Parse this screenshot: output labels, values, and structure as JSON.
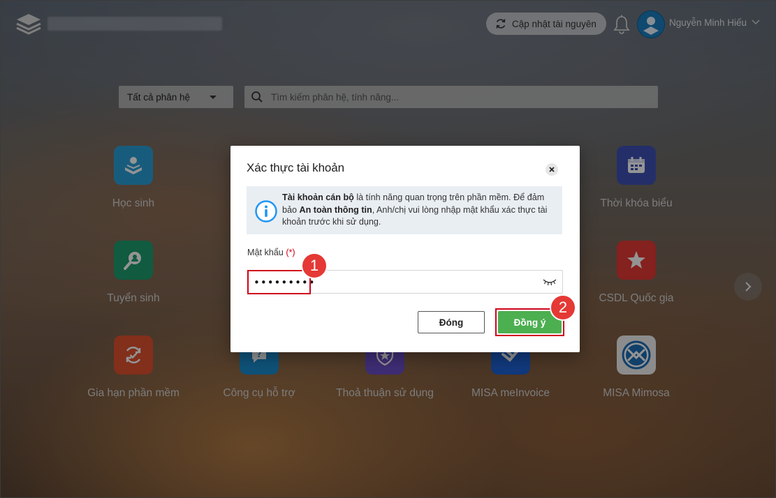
{
  "header": {
    "update_label": "Cập nhật tài nguyên",
    "user_name": "Nguyễn Minh Hiếu"
  },
  "filters": {
    "module_selected": "Tất cả phân hệ",
    "search_placeholder": "Tìm kiếm phân hệ, tính năng..."
  },
  "tiles": [
    {
      "label": "Học sinh",
      "icon": "student-book-icon",
      "color": "#2a9fd8"
    },
    {
      "label": "Thời khóa biểu",
      "icon": "calendar-icon",
      "color": "#3f51b5"
    },
    {
      "label": "Tuyển sinh",
      "icon": "search-person-icon",
      "color": "#1e9e6e"
    },
    {
      "label": "CSDL Quốc gia",
      "icon": "star-icon",
      "color": "#e53935"
    },
    {
      "label": "Gia hạn phần mềm",
      "icon": "renew-icon",
      "color": "#e0512f"
    },
    {
      "label": "Công cụ hỗ trợ",
      "icon": "help-chat-icon",
      "color": "#1b8ed0"
    },
    {
      "label": "Thoả thuận sử dụng",
      "icon": "shield-star-icon",
      "color": "#6b4fc9"
    },
    {
      "label": "MISA meInvoice",
      "icon": "meinvoice-logo-icon",
      "color": "#1e63d6"
    },
    {
      "label": "MISA Mimosa",
      "icon": "mimosa-logo-icon",
      "color": "#f2f2f2"
    }
  ],
  "dialog": {
    "title": "Xác thực tài khoản",
    "info_bold1": "Tài khoản cán bộ",
    "info_text1": " là tính năng quan trọng trên phần mềm. Để đảm bảo ",
    "info_bold2": "An toàn thông tin",
    "info_text2": ", Anh/chị vui lòng nhập mật khẩu xác thực tài khoản trước khi sử dụng.",
    "password_label": "Mật khẩu",
    "required_mark": "(*)",
    "password_value": "•••••••••",
    "cancel_label": "Đóng",
    "ok_label": "Đồng ý"
  },
  "annotations": {
    "step1": "1",
    "step2": "2"
  },
  "colors": {
    "ok_button": "#4caf50",
    "highlight": "#d0021b",
    "badge": "#e53935"
  }
}
